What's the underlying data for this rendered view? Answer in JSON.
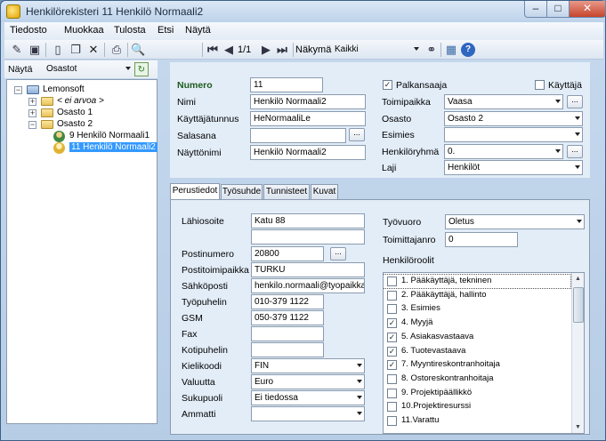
{
  "window": {
    "title": "Henkilörekisteri 11 Henkilö Normaali2"
  },
  "menu": [
    "Tiedosto",
    "Muokkaa",
    "Tulosta",
    "Etsi",
    "Näytä"
  ],
  "toolbar": {
    "page": "1/1",
    "view_label": "Näkymä",
    "view_value": "Kaikki"
  },
  "left": {
    "show_label": "Näytä",
    "show_value": "Osastot",
    "tree": [
      {
        "label": "Lemonsoft"
      },
      {
        "label": "< ei arvoa >"
      },
      {
        "label": "Osasto 1"
      },
      {
        "label": "Osasto 2"
      },
      {
        "label": "9 Henkilö Normaali1"
      },
      {
        "label": "11 Henkilö Normaali2"
      }
    ]
  },
  "top_form": {
    "numero_label": "Numero",
    "numero": "11",
    "nimi_label": "Nimi",
    "nimi": "Henkilö Normaali2",
    "kayttajatunnus_label": "Käyttäjätunnus",
    "kayttajatunnus": "HeNormaaliLe",
    "salasana_label": "Salasana",
    "salasana": "",
    "nayttonimi_label": "Näyttönimi",
    "nayttonimi": "Henkilö Normaali2",
    "palkansaaja_label": "Palkansaaja",
    "kayttaja_label": "Käyttäjä",
    "toimipaikka_label": "Toimipaikka",
    "toimipaikka": "Vaasa",
    "osasto_label": "Osasto",
    "osasto": "Osasto 2",
    "esimies_label": "Esimies",
    "esimies": "",
    "henkiloryhma_label": "Henkilöryhmä",
    "henkiloryhma": "0.",
    "laji_label": "Laji",
    "laji": "Henkilöt"
  },
  "tabs": [
    "Perustiedot",
    "Työsuhde",
    "Tunnisteet",
    "Kuvat"
  ],
  "basic": {
    "lahiosoite_label": "Lähiosoite",
    "lahiosoite": "Katu 88",
    "lahiosoite2": "",
    "postinumero_label": "Postinumero",
    "postinumero": "20800",
    "postitoimipaikka_label": "Postitoimipaikka",
    "postitoimipaikka": "TURKU",
    "sahkoposti_label": "Sähköposti",
    "sahkoposti": "henkilo.normaali@tyopaikka.cor",
    "tyopuhelin_label": "Työpuhelin",
    "tyopuhelin": "010-379 1122",
    "gsm_label": "GSM",
    "gsm": "050-379 1122",
    "fax_label": "Fax",
    "fax": "",
    "kotipuhelin_label": "Kotipuhelin",
    "kotipuhelin": "",
    "kielikoodi_label": "Kielikoodi",
    "kielikoodi": "FIN",
    "valuutta_label": "Valuutta",
    "valuutta": "Euro",
    "sukupuoli_label": "Sukupuoli",
    "sukupuoli": "Ei tiedossa",
    "ammatti_label": "Ammatti",
    "ammatti": "",
    "tyovuoro_label": "Työvuoro",
    "tyovuoro": "Oletus",
    "toimittajanro_label": "Toimittajanro",
    "toimittajanro": "0",
    "roolit_label": "Henkilöroolit"
  },
  "roles": [
    {
      "label": "1. Pääkäyttäjä, tekninen",
      "checked": false
    },
    {
      "label": "2. Pääkäyttäjä, hallinto",
      "checked": false
    },
    {
      "label": "3. Esimies",
      "checked": false
    },
    {
      "label": "4. Myyjä",
      "checked": true
    },
    {
      "label": "5. Asiakasvastaava",
      "checked": true
    },
    {
      "label": "6. Tuotevastaava",
      "checked": true
    },
    {
      "label": "7. Myyntireskontranhoitaja",
      "checked": true
    },
    {
      "label": "8. Ostoreskontranhoitaja",
      "checked": false
    },
    {
      "label": "9. Projektipäällikkö",
      "checked": false
    },
    {
      "label": "10.Projektiresurssi",
      "checked": false
    },
    {
      "label": "11.Varattu",
      "checked": false
    }
  ]
}
